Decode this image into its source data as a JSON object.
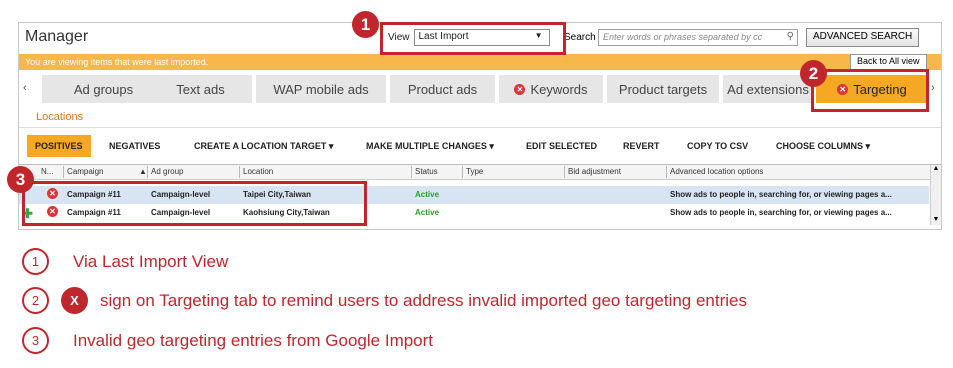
{
  "app": {
    "title": "Manager",
    "view_label": "View",
    "view_value": "Last Import",
    "search_label": "Search",
    "search_placeholder": "Enter words or phrases separated by cc",
    "advanced_search": "ADVANCED SEARCH",
    "banner": "You are viewing items that were last imported.",
    "back_button": "Back to All view"
  },
  "tabs": [
    {
      "label": "Ad groups"
    },
    {
      "label": "Text ads"
    },
    {
      "label": "WAP mobile ads"
    },
    {
      "label": "Product ads"
    },
    {
      "label": "Keywords"
    },
    {
      "label": "Product targets"
    },
    {
      "label": "Ad extensions"
    },
    {
      "label": "Targeting"
    }
  ],
  "subnav": "Locations",
  "toolbar": {
    "positives": "POSITIVES",
    "negatives": "NEGATIVES",
    "create": "CREATE A LOCATION TARGET",
    "multiple": "MAKE MULTIPLE CHANGES",
    "edit": "EDIT SELECTED",
    "revert": "REVERT",
    "copy": "COPY TO CSV",
    "columns": "CHOOSE COLUMNS"
  },
  "grid": {
    "columns": [
      "N...",
      "Campaign",
      "Ad group",
      "Location",
      "Status",
      "Type",
      "Bid adjustment",
      "Advanced location options"
    ],
    "rows": [
      {
        "campaign": "Campaign #11",
        "ad_group": "Campaign-level",
        "location": "Taipei City,Taiwan",
        "status": "Active",
        "advanced": "Show ads to people in, searching for, or viewing pages a..."
      },
      {
        "campaign": "Campaign #11",
        "ad_group": "Campaign-level",
        "location": "Kaohsiung City,Taiwan",
        "status": "Active",
        "advanced": "Show ads to people in, searching for, or viewing pages a..."
      }
    ]
  },
  "callouts": [
    "1",
    "2",
    "3"
  ],
  "legend": [
    {
      "num": "1",
      "text": "Via Last Import View"
    },
    {
      "num": "2",
      "icon": "X",
      "text": "sign on Targeting tab to remind users to address invalid imported geo targeting entries"
    },
    {
      "num": "3",
      "text": "Invalid geo targeting entries from Google Import"
    }
  ],
  "colors": {
    "accent": "#f7a823",
    "callout": "#c0272d",
    "status_active": "#2d9c2d"
  }
}
